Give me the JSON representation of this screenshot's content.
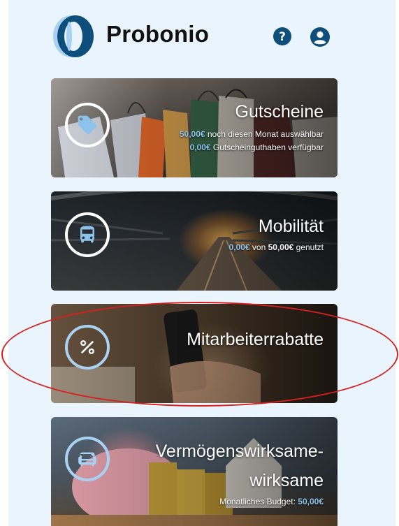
{
  "header": {
    "brand": "Probonio",
    "help_icon": "help-circle-icon",
    "account_icon": "account-circle-icon"
  },
  "colors": {
    "panel_bg": "#eaf4fd",
    "brand_blue": "#0d4f7a",
    "accent_light_blue": "#8dc3ea",
    "annotation_red": "#d42020"
  },
  "cards": [
    {
      "id": "gutscheine",
      "title": "Gutscheine",
      "icon": "tag-icon",
      "lines": [
        {
          "amount": "50,00€",
          "text": " noch diesen Monat auswählbar"
        },
        {
          "amount": "0,00€",
          "text": " Gutscheinguthaben verfügbar"
        }
      ]
    },
    {
      "id": "mobilitaet",
      "title": "Mobilität",
      "icon": "bus-icon",
      "line": {
        "used": "0,00€",
        "of": " von ",
        "total": "50,00€",
        "suffix": " genutzt"
      }
    },
    {
      "id": "rabatte",
      "title": "Mitarbeiterrabatte",
      "icon": "percent-icon"
    },
    {
      "id": "vwl",
      "title_line1": "Vermögenswirksame-",
      "title_line2": "wirksame",
      "icon": "armchair-icon",
      "line": {
        "label": "Monatliches Budget: ",
        "amount": "50,00€"
      }
    }
  ]
}
